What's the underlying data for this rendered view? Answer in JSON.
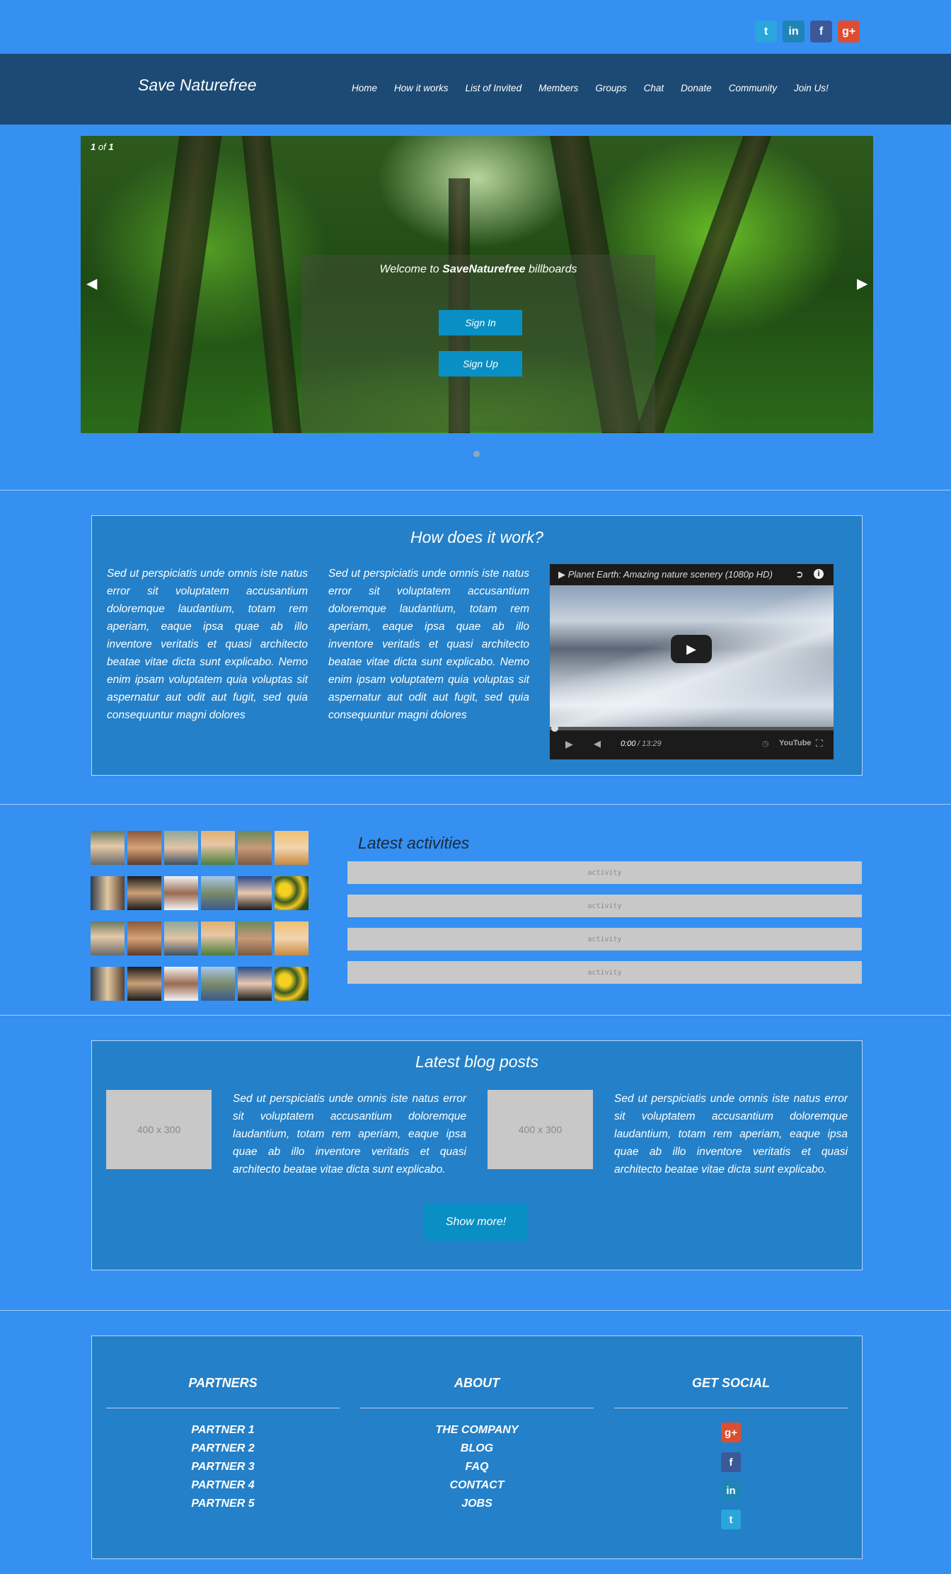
{
  "site": {
    "logo": "Save Naturefree"
  },
  "top_social": [
    "twitter-icon",
    "linkedin-icon",
    "facebook-icon",
    "google-plus-icon"
  ],
  "nav": [
    "Home",
    "How it works",
    "List of Invited",
    "Members",
    "Groups",
    "Chat",
    "Donate",
    "Community",
    "Join Us!"
  ],
  "slider": {
    "counter_current": "1",
    "counter_of": "of",
    "counter_total": "1",
    "welcome_prefix": "Welcome to ",
    "welcome_brand": "SaveNaturefree",
    "welcome_suffix": " billboards",
    "signin_label": "Sign In",
    "signup_label": "Sign Up"
  },
  "how": {
    "title": "How does it work?",
    "col1": "Sed ut perspiciatis unde omnis iste natus error sit voluptatem accusantium doloremque laudantium, totam rem aperiam, eaque ipsa quae ab illo inventore veritatis et quasi architecto beatae vitae dicta sunt explicabo. Nemo enim ipsam voluptatem quia voluptas sit aspernatur aut odit aut fugit, sed quia consequuntur magni dolores",
    "col2": "Sed ut perspiciatis unde omnis iste natus error sit voluptatem accusantium doloremque laudantium, totam rem aperiam, eaque ipsa quae ab illo inventore veritatis et quasi architecto beatae vitae dicta sunt explicabo. Nemo enim ipsam voluptatem quia voluptas sit aspernatur aut odit aut fugit, sed quia consequuntur magni dolores",
    "video_title": "Planet Earth: Amazing nature scenery (1080p HD)",
    "video_time_current": "0:00",
    "video_time_total": "/ 13:29",
    "video_brand": "YouTube"
  },
  "activities": {
    "title": "Latest activities",
    "items": [
      "activity",
      "activity",
      "activity",
      "activity"
    ]
  },
  "blog": {
    "title": "Latest blog posts",
    "placeholder": "400 x 300",
    "post1": "Sed ut perspiciatis unde omnis iste natus error sit voluptatem accusantium doloremque laudantium, totam rem aperiam, eaque ipsa quae ab illo inventore veritatis et quasi architecto beatae vitae dicta sunt explicabo.",
    "post2": "Sed ut perspiciatis unde omnis iste natus error sit voluptatem accusantium doloremque laudantium, totam rem aperiam, eaque ipsa quae ab illo inventore veritatis et quasi architecto beatae vitae dicta sunt explicabo.",
    "more_label": "Show more!"
  },
  "footer": {
    "partners_title": "PARTNERS",
    "partners": [
      "PARTNER 1",
      "PARTNER 2",
      "PARTNER 3",
      "PARTNER 4",
      "PARTNER 5"
    ],
    "about_title": "ABOUT",
    "about": [
      "THE COMPANY",
      "BLOG",
      "FAQ",
      "CONTACT",
      "JOBS"
    ],
    "social_title": "GET SOCIAL",
    "social": [
      "google-plus-icon",
      "facebook-icon",
      "linkedin-icon",
      "twitter-icon"
    ]
  },
  "colors": {
    "page_bg": "#3590f2",
    "header_bg": "#1d4a74",
    "box_bg": "#2480c8",
    "button_bg": "#0a8fc4"
  }
}
